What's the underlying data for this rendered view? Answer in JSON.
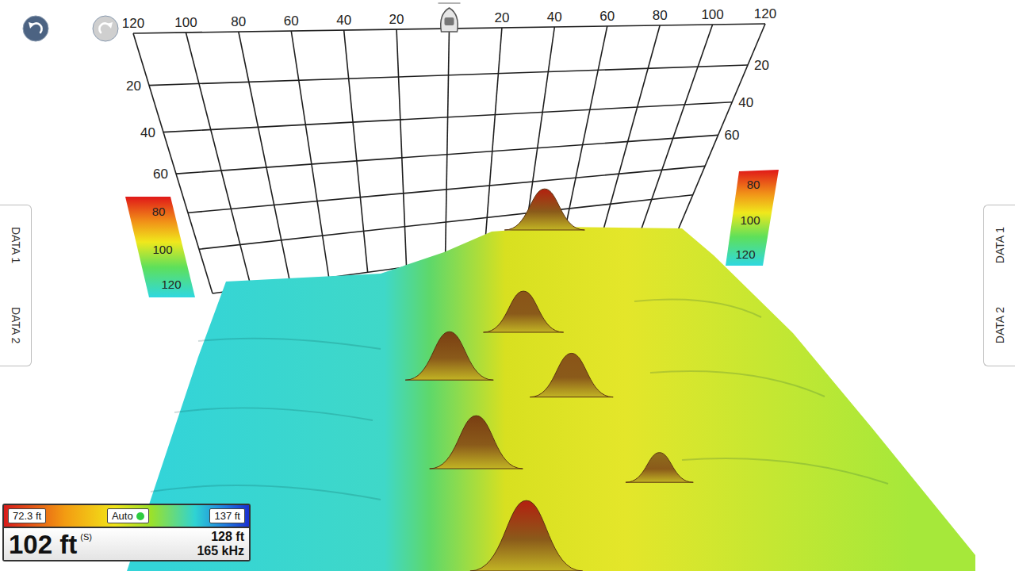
{
  "toolbar": {
    "buttons": [
      {
        "kind": "undo",
        "disabled": false
      },
      {
        "kind": "redo",
        "disabled": true
      }
    ]
  },
  "grid": {
    "top_left": [
      "120",
      "100",
      "80",
      "60",
      "40",
      "20"
    ],
    "top_right": [
      "20",
      "40",
      "60",
      "80",
      "100",
      "120"
    ],
    "left": [
      "20",
      "40",
      "60"
    ],
    "right": [
      "20",
      "40",
      "60"
    ]
  },
  "legend_left": {
    "labels": [
      "80",
      "100",
      "120"
    ]
  },
  "legend_right": {
    "labels": [
      "80",
      "100",
      "120"
    ]
  },
  "side_tabs": {
    "left": [
      "DATA 1",
      "DATA 2"
    ],
    "right": [
      "DATA 1",
      "DATA 2"
    ]
  },
  "terrain": {
    "peaks": [
      {
        "across": 48,
        "along": 0,
        "depth": 80
      },
      {
        "across": 17,
        "along": 30,
        "depth": 90
      },
      {
        "across": -18,
        "along": 44,
        "depth": 86
      },
      {
        "across": 26,
        "along": 49,
        "depth": 92
      },
      {
        "across": -15,
        "along": 70,
        "depth": 88
      },
      {
        "across": 43,
        "along": 74,
        "depth": 110
      },
      {
        "across": -7,
        "along": 100,
        "depth": 80
      }
    ]
  },
  "readout": {
    "range_min": "72.3 ft",
    "mode": "Auto",
    "mode_on": true,
    "range_max": "137 ft",
    "depth": "102 ft",
    "source": "(S)",
    "range": "128 ft",
    "frequency": "165 kHz"
  }
}
